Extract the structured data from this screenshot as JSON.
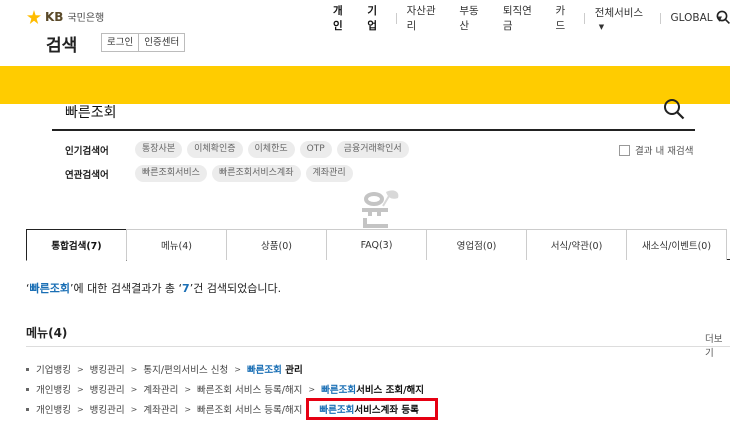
{
  "header": {
    "logo_kb": "KB",
    "logo_name": "국민은행",
    "page_title": "검색",
    "auth": [
      "로그인",
      "인증센터"
    ],
    "gnb": [
      {
        "label": "개인",
        "strong": true
      },
      {
        "label": "기업",
        "strong": true
      },
      {
        "label": "자산관리",
        "strong": false
      },
      {
        "label": "부동산",
        "strong": false
      },
      {
        "label": "퇴직연금",
        "strong": false
      },
      {
        "label": "카드",
        "strong": false
      }
    ],
    "all_services": "전체서비스",
    "global": "GLOBAL"
  },
  "search": {
    "value": "빠른조회",
    "popular_label": "인기검색어",
    "popular": [
      "통장사본",
      "이체확인증",
      "이체한도",
      "OTP",
      "금융거래확인서"
    ],
    "related_label": "연관검색어",
    "related": [
      "빠른조회서비스",
      "빠른조회서비스계좌",
      "계좌관리"
    ],
    "in_result_label": "결과 내 재검색"
  },
  "tabs": [
    {
      "label": "통합검색(7)",
      "active": true
    },
    {
      "label": "메뉴(4)",
      "active": false
    },
    {
      "label": "상품(0)",
      "active": false
    },
    {
      "label": "FAQ(3)",
      "active": false
    },
    {
      "label": "영업점(0)",
      "active": false
    },
    {
      "label": "서식/약관(0)",
      "active": false
    },
    {
      "label": "새소식/이벤트(0)",
      "active": false
    }
  ],
  "result": {
    "open_quote": "‘",
    "keyword": "빠른조회",
    "middle": "’에 대한 검색결과가 총 ‘",
    "count": "7",
    "tail": "’건 검색되었습니다."
  },
  "menu_section": {
    "title": "메뉴(4)",
    "more": "더보기",
    "rows": [
      {
        "path": [
          "기업뱅킹",
          "뱅킹관리",
          "통지/편의서비스 신청"
        ],
        "end_hl": "빠른조회",
        "end_rest": " 관리",
        "boxed": false
      },
      {
        "path": [
          "개인뱅킹",
          "뱅킹관리",
          "계좌관리",
          "빠른조회 서비스 등록/해지"
        ],
        "end_hl": "빠른조회",
        "end_rest": "서비스 조회/해지",
        "boxed": false
      },
      {
        "path": [
          "개인뱅킹",
          "뱅킹관리",
          "계좌관리",
          "빠른조회 서비스 등록/해지"
        ],
        "end_hl": "빠른조회",
        "end_rest": "서비스계좌 등록",
        "boxed": true
      }
    ]
  },
  "colors": {
    "brand_yellow": "#ffcc00",
    "highlight": "#1a6fb5",
    "box_red": "#e60012"
  }
}
